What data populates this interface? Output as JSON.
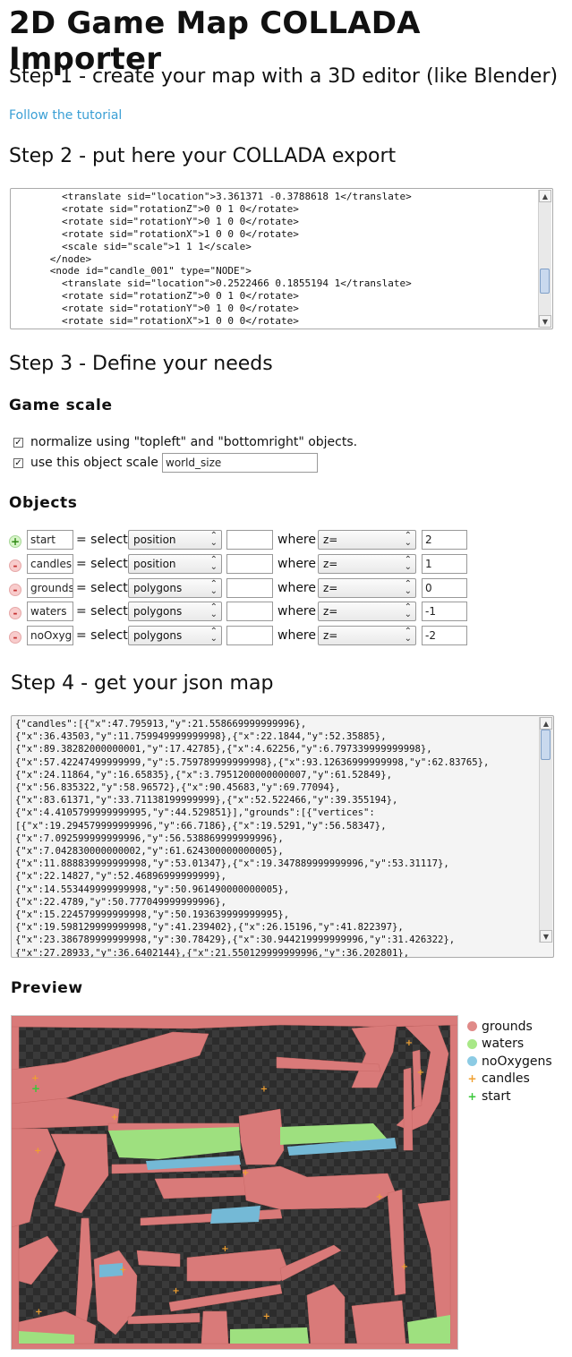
{
  "page": {
    "title": "2D Game Map COLLADA Importer"
  },
  "step1": {
    "heading": "Step 1 - create your map with a 3D editor (like Blender)",
    "link_text": "Follow the tutorial"
  },
  "step2": {
    "heading": "Step 2 - put here your COLLADA export",
    "textarea_value": "        <translate sid=\"location\">3.361371 -0.3788618 1</translate>\n        <rotate sid=\"rotationZ\">0 0 1 0</rotate>\n        <rotate sid=\"rotationY\">0 1 0 0</rotate>\n        <rotate sid=\"rotationX\">1 0 0 0</rotate>\n        <scale sid=\"scale\">1 1 1</scale>\n      </node>\n      <node id=\"candle_001\" type=\"NODE\">\n        <translate sid=\"location\">0.2522466 0.1855194 1</translate>\n        <rotate sid=\"rotationZ\">0 0 1 0</rotate>\n        <rotate sid=\"rotationY\">0 1 0 0</rotate>\n        <rotate sid=\"rotationX\">1 0 0 0</rotate>"
  },
  "step3": {
    "heading": "Step 3 - Define your needs",
    "game_scale": {
      "heading": "Game scale",
      "normalize_label": "normalize using \"topleft\" and \"bottomright\" objects.",
      "normalize_checked": true,
      "use_scale_label": "use this object scale :",
      "use_scale_checked": true,
      "scale_object_value": "world_size"
    },
    "objects": {
      "heading": "Objects",
      "select_word": "= select",
      "where_word": "where",
      "rows": [
        {
          "button": "+",
          "name": "start",
          "select": "position",
          "filter": "",
          "where": "z=",
          "value": "2"
        },
        {
          "button": "-",
          "name": "candles",
          "select": "position",
          "filter": "",
          "where": "z=",
          "value": "1"
        },
        {
          "button": "-",
          "name": "grounds",
          "select": "polygons",
          "filter": "",
          "where": "z=",
          "value": "0"
        },
        {
          "button": "-",
          "name": "waters",
          "select": "polygons",
          "filter": "",
          "where": "z=",
          "value": "-1"
        },
        {
          "button": "-",
          "name": "noOxygens",
          "select": "polygons",
          "filter": "",
          "where": "z=",
          "value": "-2"
        }
      ]
    }
  },
  "step4": {
    "heading": "Step 4 - get your json map",
    "json_output": "{\"candles\":[{\"x\":47.795913,\"y\":21.558669999999996},\n{\"x\":36.43503,\"y\":11.759949999999998},{\"x\":22.1844,\"y\":52.35885},\n{\"x\":89.38282000000001,\"y\":17.42785},{\"x\":4.62256,\"y\":6.797339999999998},\n{\"x\":57.42247499999999,\"y\":5.759789999999998},{\"x\":93.12636999999998,\"y\":62.83765},\n{\"x\":24.11864,\"y\":16.65835},{\"x\":3.7951200000000007,\"y\":61.52849},\n{\"x\":56.835322,\"y\":58.96572},{\"x\":90.45683,\"y\":69.77094},\n{\"x\":83.61371,\"y\":33.71138199999999},{\"x\":52.522466,\"y\":39.355194},\n{\"x\":4.4105799999999995,\"y\":44.529851}],\"grounds\":[{\"vertices\":\n[{\"x\":19.294579999999996,\"y\":66.7186},{\"x\":19.5291,\"y\":56.58347},\n{\"x\":7.092599999999996,\"y\":56.538869999999996},\n{\"x\":7.042830000000002,\"y\":61.624300000000005},\n{\"x\":11.888839999999998,\"y\":53.01347},{\"x\":19.347889999999996,\"y\":53.31117},\n{\"x\":22.14827,\"y\":52.46896999999999},\n{\"x\":14.553449999999998,\"y\":50.961490000000005},\n{\"x\":22.4789,\"y\":50.777049999999996},\n{\"x\":15.224579999999998,\"y\":50.193639999999995},\n{\"x\":19.598129999999998,\"y\":41.239402},{\"x\":26.15196,\"y\":41.822397},\n{\"x\":23.386789999999998,\"y\":30.78429},{\"x\":30.944219999999996,\"y\":31.426322},\n{\"x\":27.28933,\"y\":36.6402144},{\"x\":21.550129999999996,\"y\":36.202801},"
  },
  "preview": {
    "heading": "Preview",
    "colors": {
      "ground": "#d97a79",
      "water": "#9ee07f",
      "noOxygen": "#74b9d6",
      "candle": "#f0a030",
      "start": "#39c739"
    },
    "legend": [
      {
        "label": "grounds",
        "kind": "dot",
        "color": "#e08a88"
      },
      {
        "label": "waters",
        "kind": "dot",
        "color": "#a8e887"
      },
      {
        "label": "noOxygens",
        "kind": "dot",
        "color": "#8ccbe4"
      },
      {
        "label": "candles",
        "kind": "plus",
        "color": "#f0a030"
      },
      {
        "label": "start",
        "kind": "plus",
        "color": "#39c739"
      }
    ]
  }
}
